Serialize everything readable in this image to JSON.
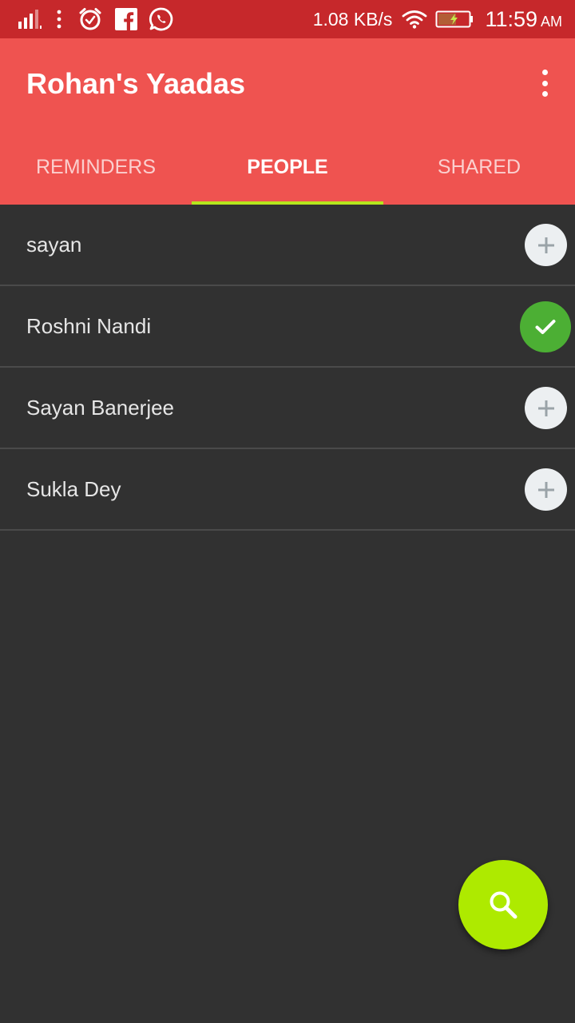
{
  "status_bar": {
    "net_speed": "1.08 KB/s",
    "time": "11:59",
    "ampm": "AM",
    "icons": [
      "signal-icon",
      "more-vert-icon",
      "alarm-icon",
      "facebook-icon",
      "whatsapp-icon",
      "wifi-icon",
      "battery-charging-icon"
    ]
  },
  "app_bar": {
    "title": "Rohan's Yaadas",
    "overflow_icon": "more-vert-icon",
    "color": "#ef5350"
  },
  "tabs": [
    {
      "label": "REMINDERS",
      "active": false
    },
    {
      "label": "PEOPLE",
      "active": true
    },
    {
      "label": "SHARED",
      "active": false
    }
  ],
  "people": [
    {
      "name": "sayan",
      "action_icon": "add-icon",
      "selected": false
    },
    {
      "name": "Roshni Nandi",
      "action_icon": "check-icon",
      "selected": true
    },
    {
      "name": "Sayan Banerjee",
      "action_icon": "add-icon",
      "selected": false
    },
    {
      "name": "Sukla Dey",
      "action_icon": "add-icon",
      "selected": false
    }
  ],
  "fab": {
    "icon": "search-icon",
    "color": "#aeea00"
  },
  "colors": {
    "status_bar": "#c6282b",
    "accent": "#b5e61d",
    "background": "#313131",
    "check": "#4caf34"
  }
}
